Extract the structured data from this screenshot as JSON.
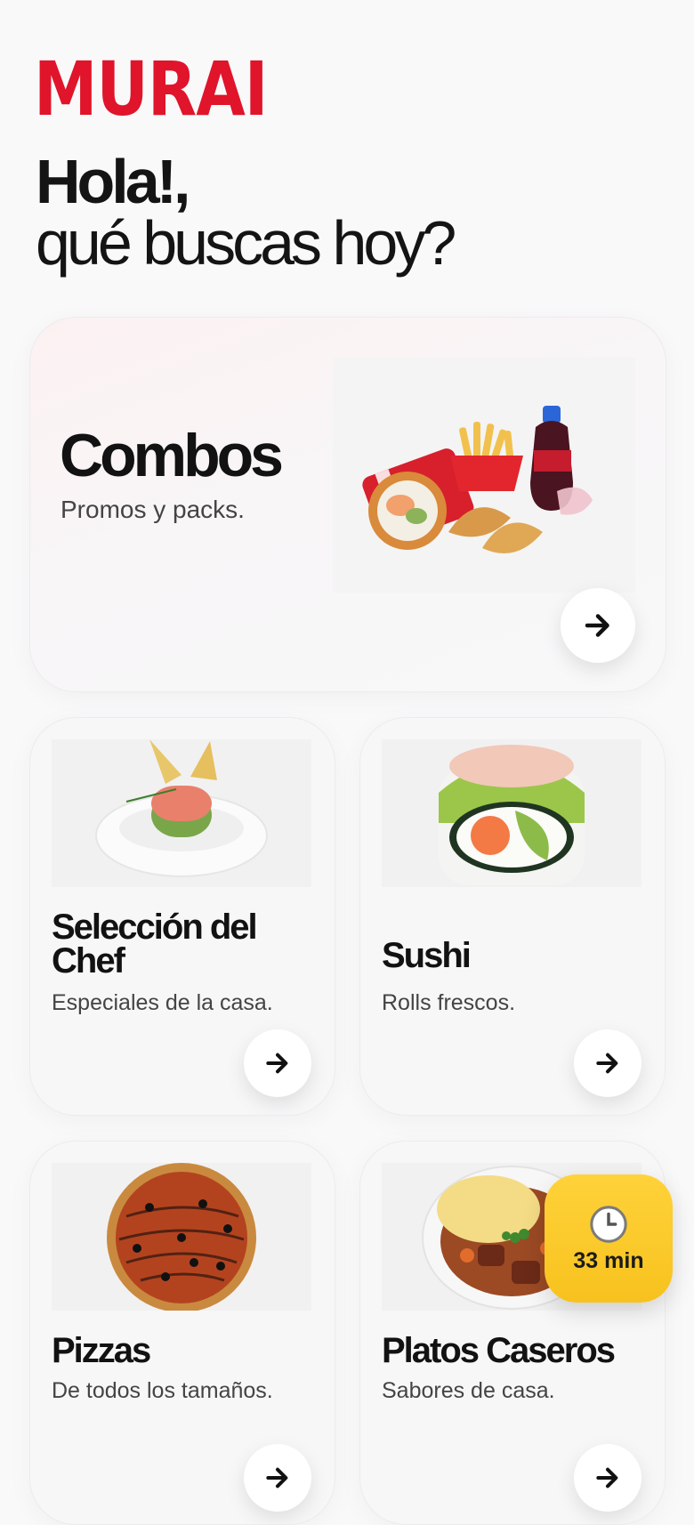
{
  "brand": {
    "logo_text": "MURAI",
    "color": "#e0142a"
  },
  "header": {
    "greeting": "Hola!,",
    "subtitle": "qué buscas hoy?"
  },
  "categories": [
    {
      "title": "Combos",
      "description": "Promos y packs.",
      "image": "combo-meal-image"
    },
    {
      "title": "Selección del Chef",
      "description": "Especiales de la casa.",
      "image": "tartare-dish-image"
    },
    {
      "title": "Sushi",
      "description": "Rolls frescos.",
      "image": "sushi-roll-image"
    },
    {
      "title": "Pizzas",
      "description": "De todos los tamaños.",
      "image": "pizza-image"
    },
    {
      "title": "Platos Caseros",
      "description": "Sabores de casa.",
      "image": "stew-mash-image"
    }
  ],
  "delivery_timer": {
    "label": "33 min",
    "icon": "clock-icon",
    "color": "#f7c21e"
  }
}
